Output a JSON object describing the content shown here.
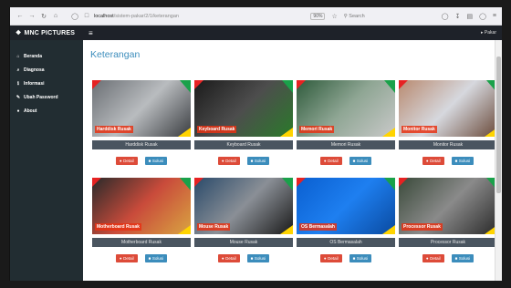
{
  "browser": {
    "back_icon": "back-arrow-icon",
    "url_host": "localhost",
    "url_path": "/sistem-pakar/2/1/keterangan",
    "zoom": "90%",
    "search_placeholder": "Search"
  },
  "header": {
    "brand": "MNC PICTURES",
    "menu_icon": "≡",
    "user": "▸ Pakar"
  },
  "sidebar": {
    "items": [
      {
        "icon": "⌂",
        "label": "Beranda"
      },
      {
        "icon": "⌕",
        "label": "Diagnosa"
      },
      {
        "icon": "ℹ",
        "label": "Informasi"
      },
      {
        "icon": "✎",
        "label": "Ubah Password"
      },
      {
        "icon": "●",
        "label": "About"
      }
    ]
  },
  "main": {
    "title": "Keterangan",
    "detail_label": "Detail",
    "solusi_label": "Solusi",
    "cards": [
      {
        "tag": "Harddisk Rusak",
        "label": "Harddisk Rusak",
        "colors": [
          "#6b6f74",
          "#b9bcbf",
          "#3a3d41"
        ]
      },
      {
        "tag": "Keyboard Rusak",
        "label": "Keyboard Rusak",
        "colors": [
          "#1b1b1b",
          "#4d4d4d",
          "#2a7a2a"
        ]
      },
      {
        "tag": "Memori Rusak",
        "label": "Memori Rusak",
        "colors": [
          "#2f5b3c",
          "#8fa694",
          "#c9c9c9"
        ]
      },
      {
        "tag": "Monitor Rusak",
        "label": "Monitor Rusak",
        "colors": [
          "#b98a70",
          "#d6d8de",
          "#6a4a3a"
        ]
      },
      {
        "tag": "Motherboard Rusak",
        "label": "Motherboard Rusak",
        "colors": [
          "#2a2a2a",
          "#c94b3b",
          "#d9a441"
        ]
      },
      {
        "tag": "Mouse Rusak",
        "label": "Mouse Rusak",
        "colors": [
          "#2a4a6a",
          "#8a8f96",
          "#1a1a1a"
        ]
      },
      {
        "tag": "OS Bermasalah",
        "label": "OS Bermasalah",
        "colors": [
          "#0a5fd0",
          "#1e7ff0",
          "#0a4aa0"
        ]
      },
      {
        "tag": "Processor Rusak",
        "label": "Processor Rusak",
        "colors": [
          "#3a4a3a",
          "#8a8a8a",
          "#2a2a2a"
        ]
      }
    ]
  }
}
